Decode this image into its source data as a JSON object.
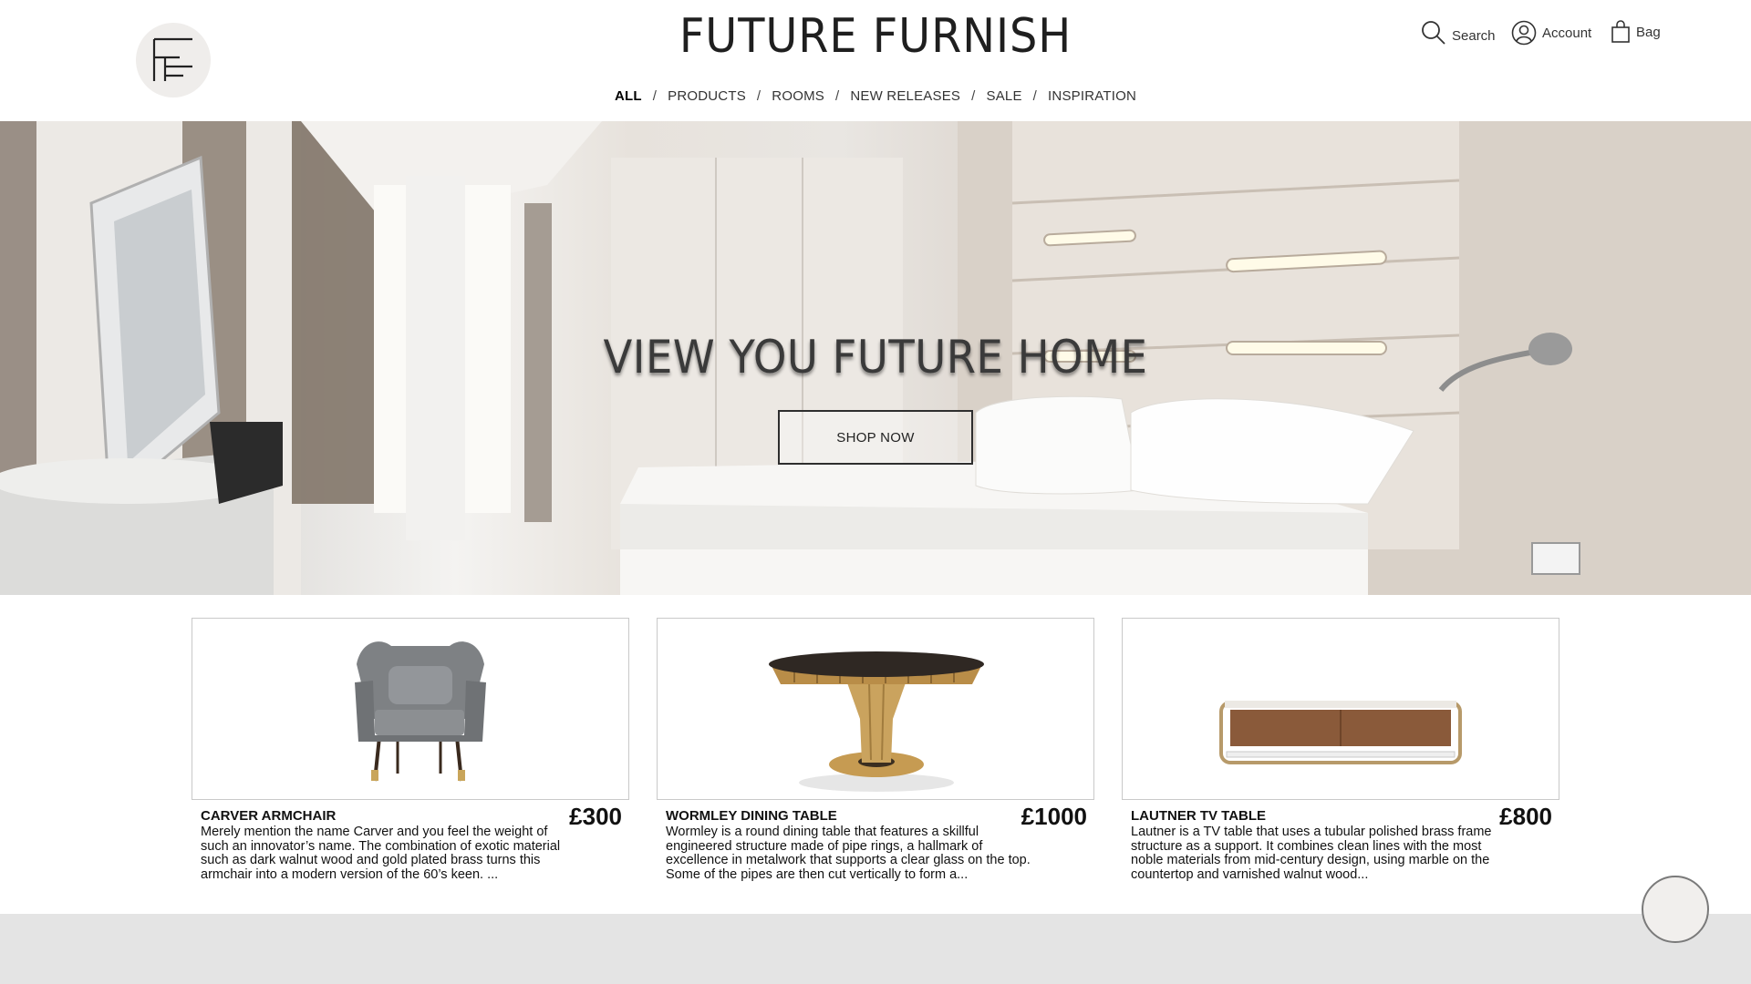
{
  "header": {
    "brand": "FUTURE FURNISH",
    "logo_icon": "ff-monogram-logo",
    "search_label": "Search",
    "account_label": "Account",
    "bag_label": "Bag"
  },
  "nav": {
    "items": [
      "ALL",
      "PRODUCTS",
      "ROOMS",
      "NEW RELEASES",
      "SALE",
      "INSPIRATION"
    ],
    "active": "ALL",
    "separator": "/"
  },
  "hero": {
    "heading": "VIEW YOU FUTURE HOME",
    "cta_label": "SHOP NOW",
    "image": "modern hotel bedroom"
  },
  "products": [
    {
      "name": "CARVER ARMCHAIR",
      "price": "£300",
      "description": "Merely mention the name Carver and you feel the weight of such an innovator’s name. The combination of exotic material such as dark walnut wood and gold plated brass turns this armchair into a modern version of the 60’s keen. ...",
      "image": "grey armchair"
    },
    {
      "name": "WORMLEY DINING TABLE",
      "price": "£1000",
      "description": "Wormley is a round dining table that features a skillful engineered structure made of pipe rings, a hallmark of excellence in metalwork that supports a clear glass on the top. Some of the pipes are then cut vertically to form a...",
      "image": "round brass dining table"
    },
    {
      "name": "LAUTNER TV TABLE",
      "price": "£800",
      "description": "Lautner is a TV table that uses a tubular polished brass frame structure as a support. It combines clean lines with the most noble materials from mid-century design, using marble on the countertop and varnished walnut wood...",
      "image": "walnut tv table"
    }
  ],
  "colors": {
    "footer_band": "#e4e4e4",
    "logo_bg": "#efedeb",
    "text": "#1a1a1a"
  }
}
